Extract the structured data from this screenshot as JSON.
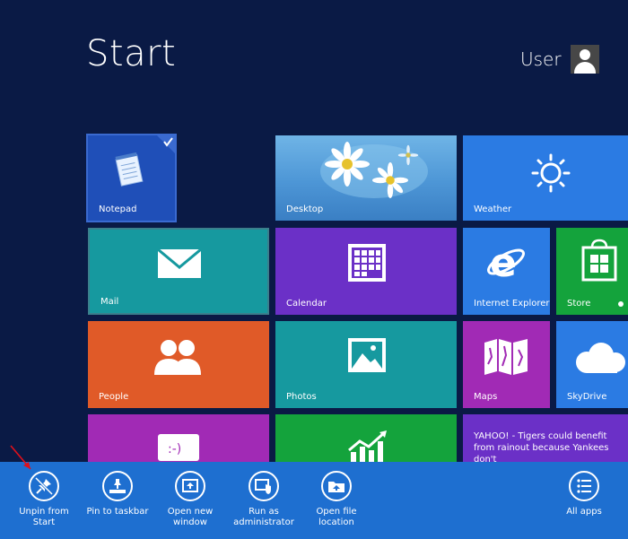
{
  "header": {
    "title": "Start",
    "user_name": "User"
  },
  "tiles": {
    "notepad": {
      "label": "Notepad",
      "selected": true
    },
    "desktop": {
      "label": "Desktop"
    },
    "weather": {
      "label": "Weather"
    },
    "mail": {
      "label": "Mail"
    },
    "calendar": {
      "label": "Calendar"
    },
    "ie": {
      "label": "Internet Explorer"
    },
    "store": {
      "label": "Store"
    },
    "people": {
      "label": "People"
    },
    "photos": {
      "label": "Photos"
    },
    "maps": {
      "label": "Maps"
    },
    "skydrive": {
      "label": "SkyDrive"
    },
    "news": {
      "headline": "YAHOO! - Tigers could benefit from rainout because Yankees don't"
    }
  },
  "appbar": {
    "unpin": "Unpin from Start",
    "pin_taskbar": "Pin to taskbar",
    "new_window_1": "Open new",
    "new_window_2": "window",
    "run_admin_1": "Run as",
    "run_admin_2": "administrator",
    "open_location_1": "Open file",
    "open_location_2": "location",
    "all_apps": "All apps"
  },
  "colors": {
    "background": "#0a1a45",
    "appbar": "#1e6fd0",
    "teal": "#16999f",
    "purple": "#6b30c7",
    "blue": "#2b7be3",
    "orange": "#e05a28",
    "green": "#14a33c",
    "magenta": "#a12ab5"
  }
}
